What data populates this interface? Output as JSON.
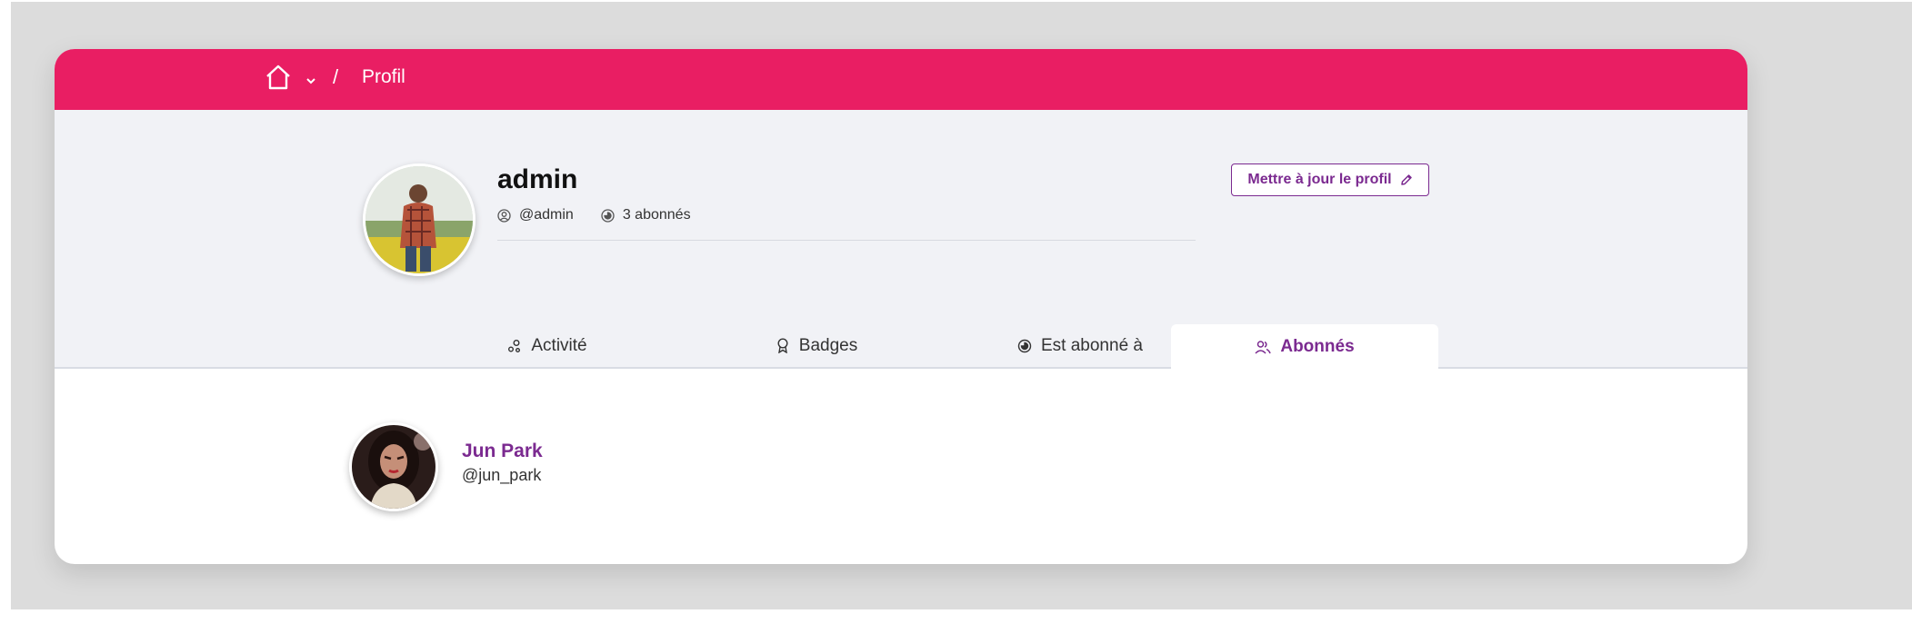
{
  "breadcrumb": {
    "home_icon": "home-icon",
    "dropdown_icon": "chevron-down-icon",
    "separator": "/",
    "current": "Profil"
  },
  "profile": {
    "username": "admin",
    "handle": "@admin",
    "followers": "3 abonnés",
    "update_button": "Mettre à jour le profil",
    "update_icon": "pencil-icon"
  },
  "tabs": [
    {
      "label": "Activité",
      "icon": "activity-icon",
      "active": false
    },
    {
      "label": "Badges",
      "icon": "badge-icon",
      "active": false
    },
    {
      "label": "Est abonné à",
      "icon": "following-icon",
      "active": false
    },
    {
      "label": "Abonnés",
      "icon": "followers-icon",
      "active": true
    }
  ],
  "followers_list": [
    {
      "name": "Jun Park",
      "handle": "@jun_park"
    }
  ],
  "colors": {
    "accent": "#e91e63",
    "link": "#7b2a90",
    "profile_bg": "#f1f2f6"
  }
}
